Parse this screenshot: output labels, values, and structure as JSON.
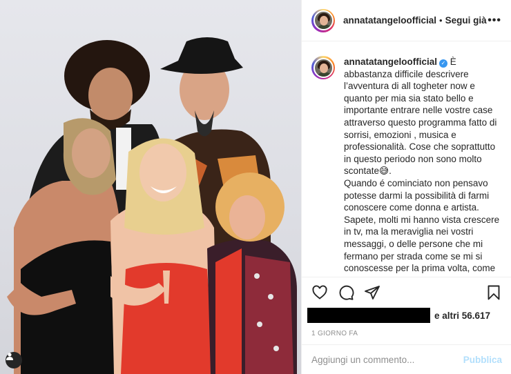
{
  "post": {
    "username": "annatatangeloofficial",
    "dot": "•",
    "follow_label": "Segui già",
    "more_label": "•••",
    "caption": "È abbastanza difficile descrivere l’avventura di all togheter now e quanto per mia sia stato bello e importante entrare nelle vostre case attraverso questo programma fatto di sorrisi, emozioni , musica e professionalità. Cose che soprattutto in questo periodo non sono molto scontate😅.\nQuando é cominciato non pensavo potesse darmi la possibilità di farmi conoscere come donna e artista. Sapete, molti mi hanno vista crescere in tv, ma la meraviglia nei vostri messaggi, o delle persone che mi fermano per strada come se mi si conoscesse per la prima volta, come se avessero ritrovato un Anna",
    "likes_text": "e altri 56.617",
    "time": "1 GIORNO FA"
  },
  "comment": {
    "placeholder": "Aggiungi un commento...",
    "publish_label": "Pubblica"
  },
  "icons": {
    "like": "heart-icon",
    "comment": "speech-bubble-icon",
    "share": "paper-plane-icon",
    "save": "bookmark-icon",
    "tag": "person-icon",
    "more": "more-dots-icon"
  },
  "colors": {
    "link_disabled": "#b2dffc",
    "verified": "#3897f0",
    "dress_red": "#e23a2c"
  }
}
